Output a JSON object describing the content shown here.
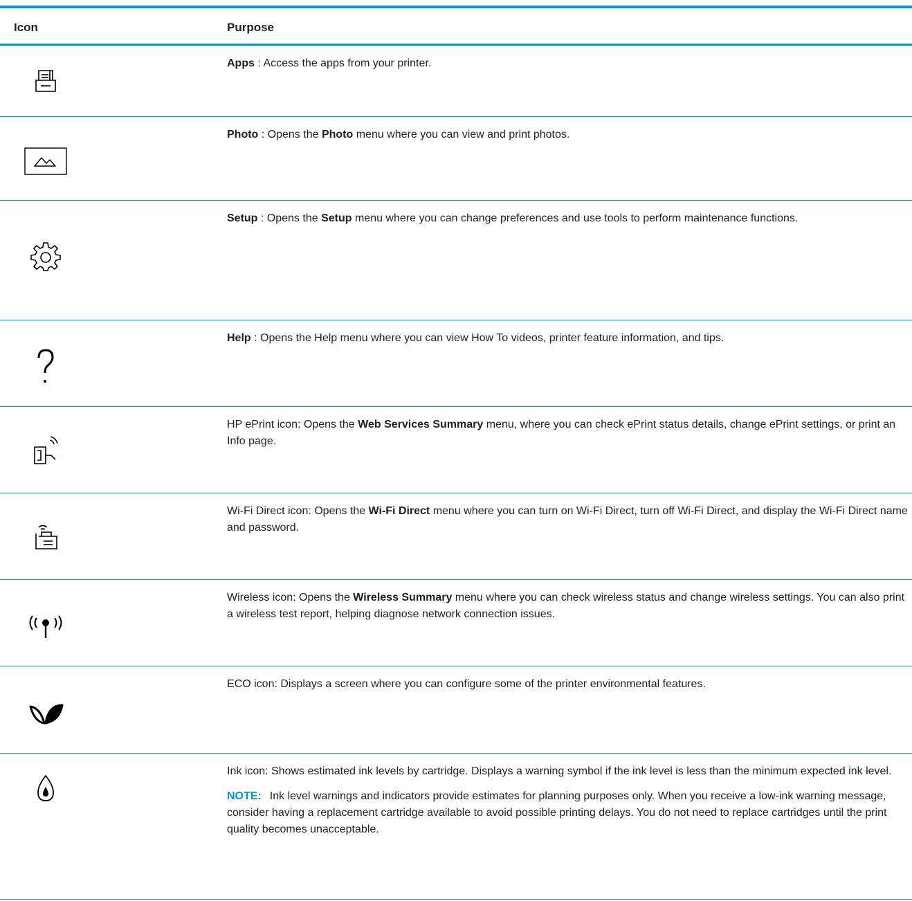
{
  "header": {
    "icon_col": "Icon",
    "purpose_col": "Purpose"
  },
  "rows": [
    {
      "icon": "apps-icon",
      "b1": "Apps",
      "t1": " : Access the apps from your printer."
    },
    {
      "icon": "photo-icon",
      "b1": "Photo",
      "t1": " : Opens the ",
      "b2": "Photo",
      "t2": " menu where you can view and print photos."
    },
    {
      "icon": "setup-gear-icon",
      "b1": "Setup",
      "t1": " : Opens the ",
      "b2": "Setup",
      "t2": " menu where you can change preferences and use tools to perform maintenance functions."
    },
    {
      "icon": "help-icon",
      "b1": "Help",
      "t1": " : Opens the Help menu where you can view How To videos, printer feature information, and tips."
    },
    {
      "icon": "eprint-icon",
      "t0": "HP ePrint icon: Opens the ",
      "b1": "Web Services Summary",
      "t1": " menu, where you can check ePrint status details, change ePrint settings, or print an Info page."
    },
    {
      "icon": "wifi-direct-icon",
      "t0": "Wi-Fi Direct icon: Opens the ",
      "b1": "Wi-Fi Direct",
      "t1": " menu where you can turn on Wi-Fi Direct, turn off Wi-Fi Direct, and display the Wi-Fi Direct name and password."
    },
    {
      "icon": "wireless-icon",
      "t0": "Wireless icon: Opens the ",
      "b1": "Wireless Summary",
      "t1": " menu where you can check wireless status and change wireless settings. You can also print a wireless test report, helping diagnose network connection issues."
    },
    {
      "icon": "eco-icon",
      "t0": "ECO icon: Displays a screen where you can configure some of the printer environmental features."
    },
    {
      "icon": "ink-icon",
      "t0": "Ink icon: Shows estimated ink levels by cartridge. Displays a warning symbol if the ink level is less than the minimum expected ink level.",
      "note_label": "NOTE:",
      "note_text": "Ink level warnings and indicators provide estimates for planning purposes only. When you receive a low-ink warning message, consider having a replacement cartridge available to avoid possible printing delays. You do not need to replace cartridges until the print quality becomes unacceptable."
    }
  ]
}
